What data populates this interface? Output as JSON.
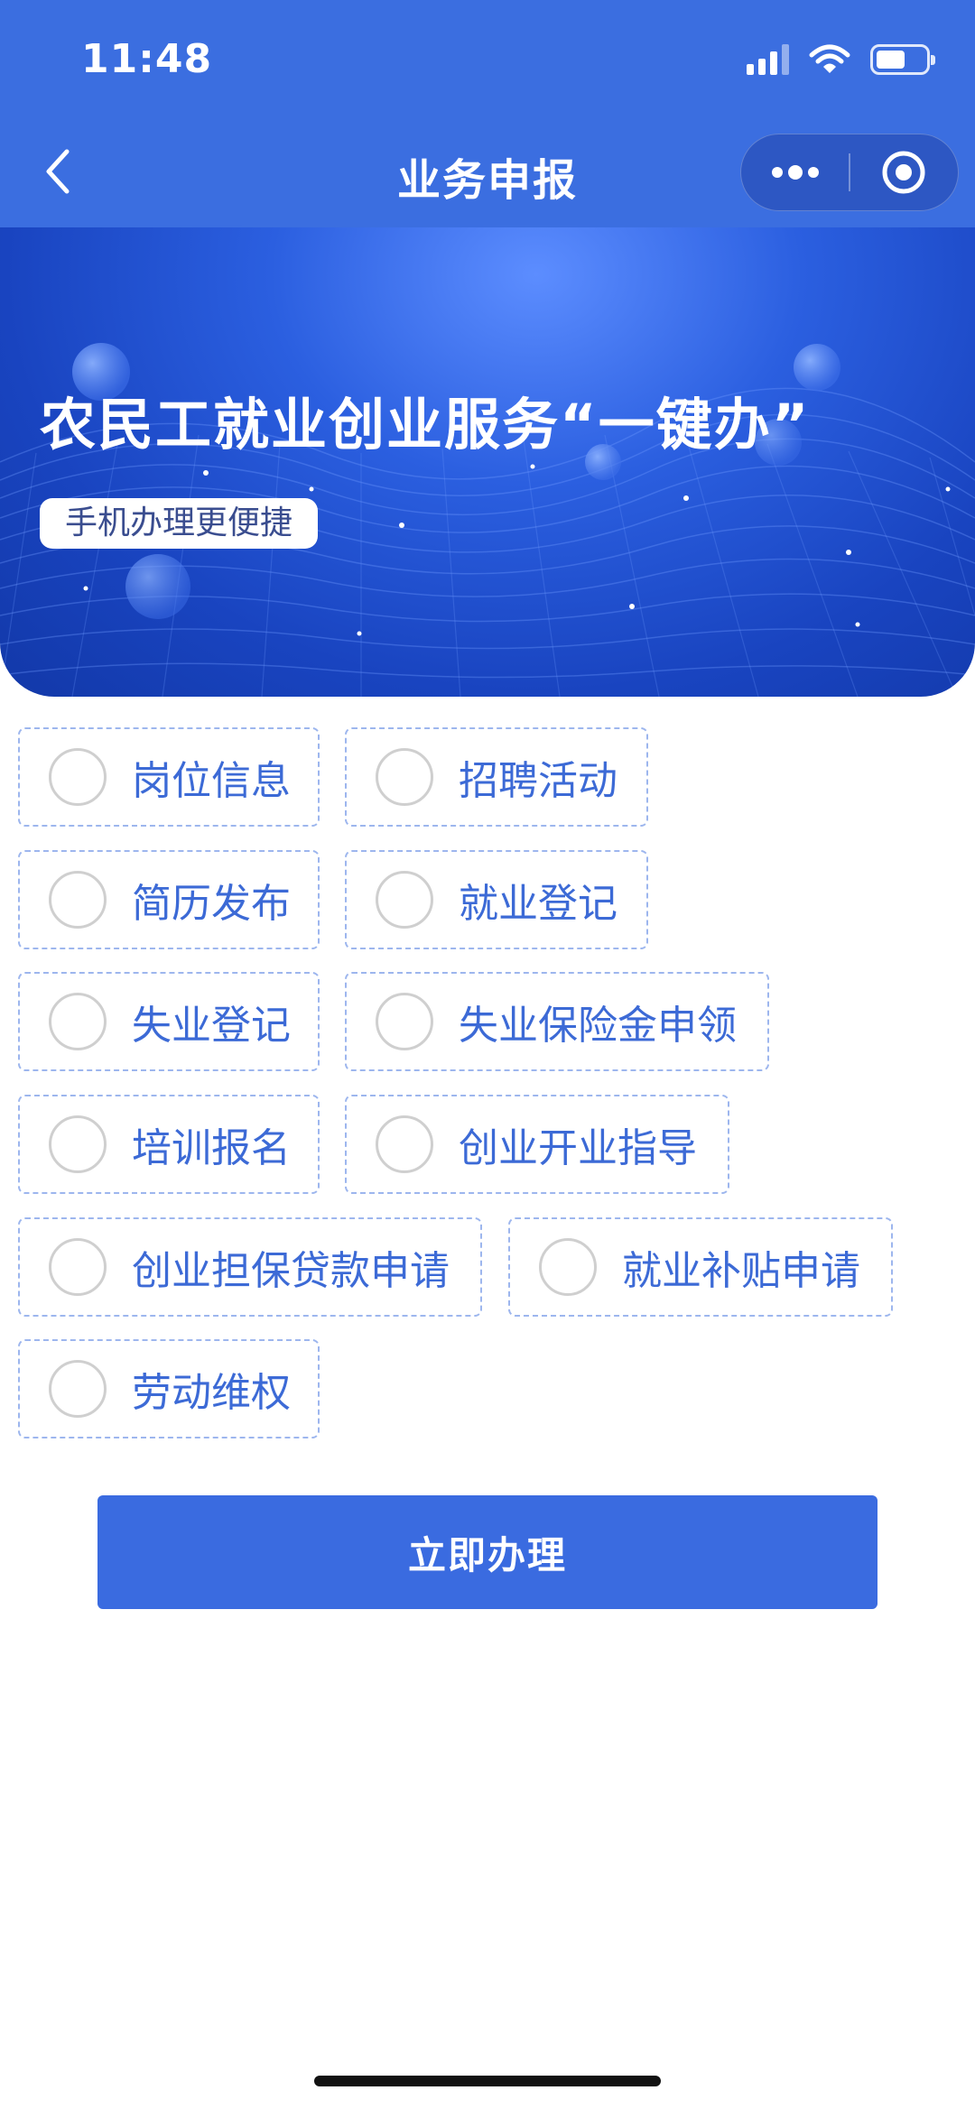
{
  "status_bar": {
    "time": "11:48"
  },
  "nav": {
    "title": "业务申报"
  },
  "banner": {
    "title": "农民工就业创业服务“一键办”",
    "subtitle": "手机办理更便捷"
  },
  "options": [
    {
      "label": "岗位信息"
    },
    {
      "label": "招聘活动"
    },
    {
      "label": "简历发布"
    },
    {
      "label": "就业登记"
    },
    {
      "label": "失业登记"
    },
    {
      "label": "失业保险金申领"
    },
    {
      "label": "培训报名"
    },
    {
      "label": "创业开业指导"
    },
    {
      "label": "创业担保贷款申请"
    },
    {
      "label": "就业补贴申请"
    },
    {
      "label": "劳动维权"
    }
  ],
  "submit": {
    "label": "立即办理"
  },
  "colors": {
    "primary": "#3a6be0",
    "option_text": "#3c6ad6",
    "option_border": "#9db6ee"
  },
  "icons": {
    "back": "chevron-left-icon",
    "more": "more-dots-icon",
    "close": "target-circle-icon",
    "signal": "signal-icon",
    "wifi": "wifi-icon",
    "battery": "battery-icon"
  }
}
